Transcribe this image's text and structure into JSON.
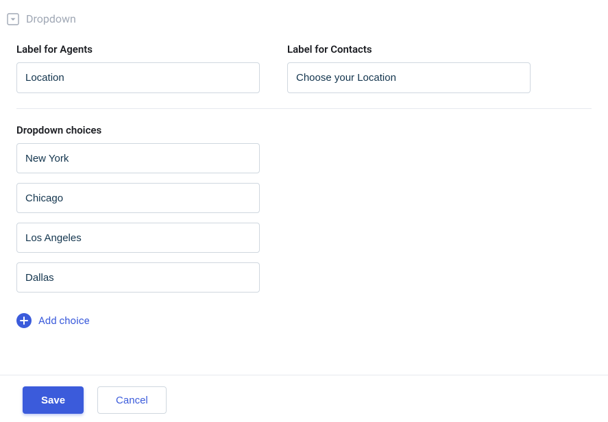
{
  "fieldType": {
    "label": "Dropdown"
  },
  "labels": {
    "agents": {
      "title": "Label for Agents",
      "value": "Location"
    },
    "contacts": {
      "title": "Label for Contacts",
      "value": "Choose your Location"
    }
  },
  "choices": {
    "title": "Dropdown choices",
    "items": [
      "New York",
      "Chicago",
      "Los Angeles",
      "Dallas"
    ],
    "addLabel": "Add choice"
  },
  "footer": {
    "save": "Save",
    "cancel": "Cancel"
  }
}
